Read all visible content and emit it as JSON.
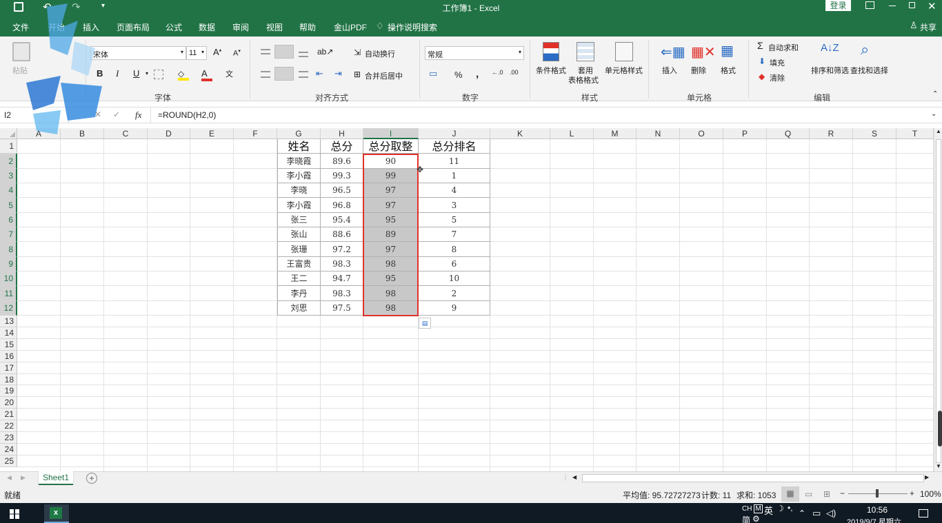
{
  "title": {
    "text": "工作簿1  -  Excel",
    "login": "登录"
  },
  "menu": [
    "文件",
    "开始",
    "插入",
    "页面布局",
    "公式",
    "数据",
    "审阅",
    "视图",
    "帮助",
    "金山PDF",
    "操作说明搜索"
  ],
  "share": "共享",
  "ribbon": {
    "paste": "粘贴",
    "font_name": "宋体",
    "font_size": "11",
    "font_group": "字体",
    "wrap_text": "自动换行",
    "merge_center": "合并后居中",
    "align_group": "对齐方式",
    "number_format": "常规",
    "number_group": "数字",
    "cond_format": "条件格式",
    "table_format_1": "套用",
    "table_format_2": "表格格式",
    "cell_style": "单元格样式",
    "style_group": "样式",
    "insert": "插入",
    "delete": "删除",
    "format": "格式",
    "cells_group": "单元格",
    "autosum": "自动求和",
    "fill": "填充",
    "clear": "清除",
    "sort_filter": "排序和筛选",
    "find_select": "查找和选择",
    "edit_group": "编辑",
    "bold": "B",
    "italic": "I",
    "underline": "U",
    "percent": "%"
  },
  "formula_bar": {
    "name_box": "I2",
    "fx": "fx",
    "formula": "=ROUND(H2,0)"
  },
  "columns": [
    "A",
    "B",
    "C",
    "D",
    "E",
    "F",
    "G",
    "H",
    "I",
    "J",
    "K",
    "L",
    "M",
    "N",
    "O",
    "P",
    "Q",
    "R",
    "S",
    "T"
  ],
  "rows": [
    "1",
    "2",
    "3",
    "4",
    "5",
    "6",
    "7",
    "8",
    "9",
    "10",
    "11",
    "12",
    "13",
    "14",
    "15",
    "16",
    "17",
    "18",
    "19",
    "20",
    "21",
    "22",
    "23",
    "24",
    "25"
  ],
  "table": {
    "headers": [
      "姓名",
      "总分",
      "总分取整",
      "总分排名"
    ],
    "rows": [
      [
        "李晓霞",
        "89.6",
        "90",
        "11"
      ],
      [
        "李小霞",
        "99.3",
        "99",
        "1"
      ],
      [
        "李晓",
        "96.5",
        "97",
        "4"
      ],
      [
        "李小霞",
        "96.8",
        "97",
        "3"
      ],
      [
        "张三",
        "95.4",
        "95",
        "5"
      ],
      [
        "张山",
        "88.6",
        "89",
        "7"
      ],
      [
        "张珊",
        "97.2",
        "97",
        "8"
      ],
      [
        "王富贵",
        "98.3",
        "98",
        "6"
      ],
      [
        "王二",
        "94.7",
        "95",
        "10"
      ],
      [
        "李丹",
        "98.3",
        "98",
        "2"
      ],
      [
        "刘思",
        "97.5",
        "98",
        "9"
      ]
    ]
  },
  "sheet_tab": "Sheet1",
  "status": {
    "ready": "就绪",
    "average": "平均值: 95.72727273",
    "count": "计数: 11",
    "sum": "求和: 1053",
    "zoom": "100%"
  },
  "taskbar": {
    "ime1": "CH",
    "ime2": "英",
    "ime3": "简",
    "time": "10:56",
    "date": "2019/9/7 星期六"
  },
  "colors": {
    "brand": "#217346",
    "selection_border": "#e0312a",
    "selection_fill": "#c8c8c8"
  }
}
